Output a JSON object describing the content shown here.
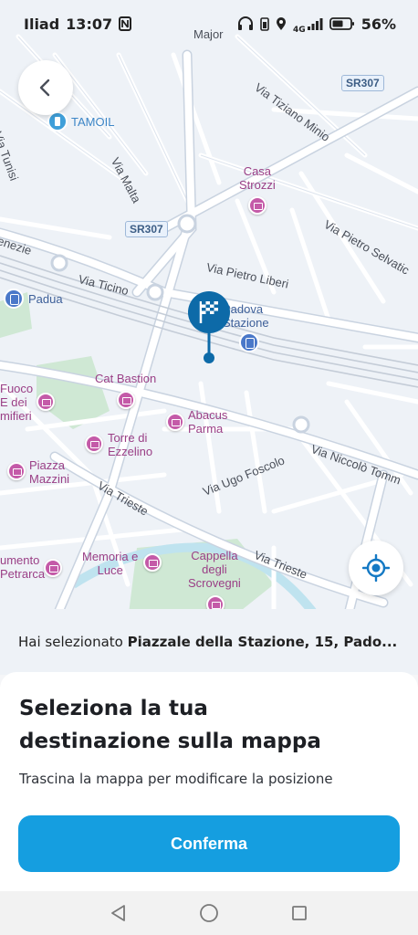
{
  "status_bar": {
    "carrier": "Iliad",
    "time": "13:07",
    "battery": "56%",
    "network": "4G"
  },
  "map": {
    "streets": [
      {
        "id": "via-tiziano-minio",
        "label": "Via Tiziano Minio"
      },
      {
        "id": "via-tunisi",
        "label": "Via Tunisi"
      },
      {
        "id": "via-malta",
        "label": "Via Malta"
      },
      {
        "id": "via-pietro-selvatico",
        "label": "Via Pietro Selvatic"
      },
      {
        "id": "via-pietro-liberi",
        "label": "Via Pietro Liberi"
      },
      {
        "id": "venezie",
        "label": "enezie"
      },
      {
        "id": "via-ticino",
        "label": "Via Ticino"
      },
      {
        "id": "via-niccolo-tommaseo",
        "label": "Via Niccolò Tomm"
      },
      {
        "id": "via-ugo-foscolo",
        "label": "Via Ugo Foscolo"
      },
      {
        "id": "via-trieste-1",
        "label": "Via Trieste"
      },
      {
        "id": "via-trieste-2",
        "label": "Via Trieste"
      },
      {
        "id": "major",
        "label": "Major"
      }
    ],
    "road_badges": [
      "SR307",
      "SR307"
    ],
    "pois": {
      "tamoil": "TAMOIL",
      "casa_strozzi": [
        "Casa",
        "Strozzi"
      ],
      "padua": "Padua",
      "padova_stazione": [
        "Padova",
        "Stazione"
      ],
      "cat_bastion": "Cat Bastion",
      "fuoco": [
        "Fuoco",
        "E dei",
        "mifieri"
      ],
      "abacus_parma": [
        "Abacus",
        "Parma"
      ],
      "torre_ezzelino": [
        "Torre di",
        "Ezzelino"
      ],
      "piazza_mazzini": [
        "Piazza",
        "Mazzini"
      ],
      "monumento_petrarca": [
        "umento",
        "Petrarca"
      ],
      "memoria_luce": [
        "Memoria e",
        "Luce"
      ],
      "cappella_scrovegni": [
        "Cappella",
        "degli",
        "Scrovegni"
      ]
    },
    "colors": {
      "map_bg": "#eef2f7",
      "road": "#ffffff",
      "road_outline": "#c9d3e0",
      "park": "#cfe8d4",
      "water": "#bfe3ef",
      "poi": "#c45aa8",
      "pin": "#0d6aa8",
      "transit": "#4a78c9"
    }
  },
  "selection": {
    "prefix": "Hai selezionato",
    "address": "Piazzale della Stazione, 15, Pado..."
  },
  "sheet": {
    "title": "Seleziona la tua destinazione sulla mappa",
    "subtitle": "Trascina la mappa per modificare la posizione",
    "confirm_label": "Conferma",
    "confirm_color": "#159ee0"
  },
  "nav_bar": {
    "back": "back-triangle-icon",
    "home": "home-circle-icon",
    "recents": "recents-square-icon"
  }
}
